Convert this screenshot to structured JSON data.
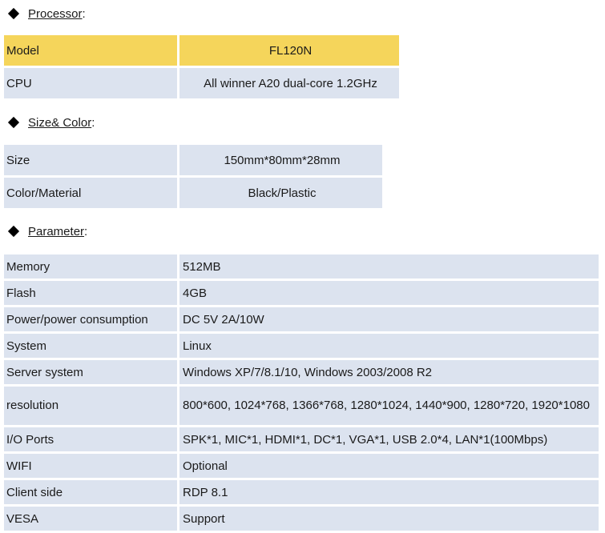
{
  "processor": {
    "heading": "Processor",
    "rows": [
      {
        "label": "Model",
        "value": "FL120N"
      },
      {
        "label": "CPU",
        "value": "All winner A20 dual-core 1.2GHz"
      }
    ]
  },
  "size_color": {
    "heading": "Size& Color",
    "rows": [
      {
        "label": "Size",
        "value": "150mm*80mm*28mm"
      },
      {
        "label": "Color/Material",
        "value": "Black/Plastic"
      }
    ]
  },
  "parameter": {
    "heading": "Parameter",
    "rows": [
      {
        "label": "Memory",
        "value": "512MB"
      },
      {
        "label": "Flash",
        "value": "4GB"
      },
      {
        "label": "Power/power consumption",
        "value": "DC 5V 2A/10W"
      },
      {
        "label": "System",
        "value": "Linux"
      },
      {
        "label": "Server system",
        "value": "Windows XP/7/8.1/10,  Windows 2003/2008 R2"
      },
      {
        "label": "resolution",
        "value": "800*600,  1024*768,  1366*768, 1280*1024,  1440*900,   1280*720,  1920*1080"
      },
      {
        "label": "I/O Ports",
        "value": "SPK*1,  MIC*1,  HDMI*1, DC*1, VGA*1,  USB 2.0*4,  LAN*1(100Mbps)"
      },
      {
        "label": "WIFI",
        "value": "Optional"
      },
      {
        "label": "Client side",
        "value": "RDP 8.1"
      },
      {
        "label": "VESA",
        "value": "Support"
      }
    ]
  }
}
